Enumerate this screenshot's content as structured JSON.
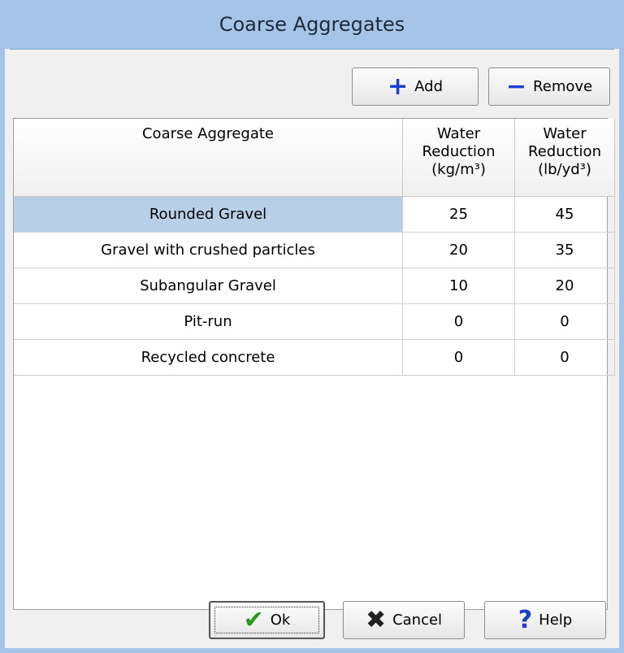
{
  "window": {
    "title": "Coarse Aggregates"
  },
  "toolbar": {
    "add_label": "Add",
    "remove_label": "Remove"
  },
  "grid": {
    "headers": [
      [
        "Coarse Aggregate"
      ],
      [
        "Water",
        "Reduction",
        "(kg/m³)"
      ],
      [
        "Water",
        "Reduction",
        "(lb/yd³)"
      ]
    ],
    "rows": [
      {
        "name": "Rounded Gravel",
        "kg": "25",
        "lb": "45"
      },
      {
        "name": "Gravel with crushed particles",
        "kg": "20",
        "lb": "35"
      },
      {
        "name": "Subangular Gravel",
        "kg": "10",
        "lb": "20"
      },
      {
        "name": "Pit-run",
        "kg": "0",
        "lb": "0"
      },
      {
        "name": "Recycled concrete",
        "kg": "0",
        "lb": "0"
      }
    ]
  },
  "footer": {
    "ok_label": "Ok",
    "cancel_label": "Cancel",
    "help_label": "Help"
  },
  "colors": {
    "titlebar": "#a6c4e6",
    "selection": "#b8cfe8",
    "accent": "#1a3fd0"
  }
}
